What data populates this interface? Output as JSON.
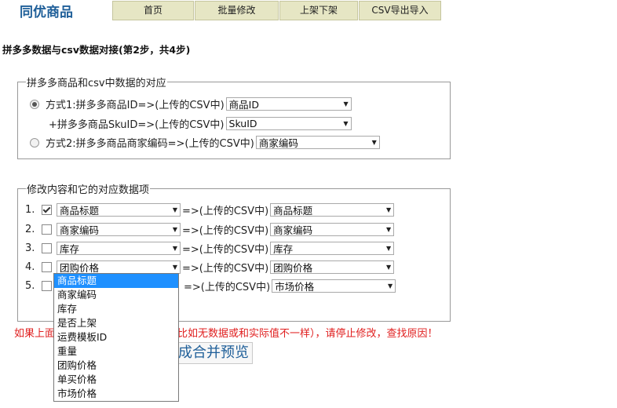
{
  "logo": "同优商品",
  "nav": [
    "首页",
    "批量修改",
    "上架下架",
    "CSV导出导入"
  ],
  "step_title": "拼多多数据与csv数据对接(第2步，共4步)",
  "match_box": {
    "legend": "拼多多商品和csv中数据的对应",
    "mode1_label": "方式1:拼多多商品ID=>(上传的CSV中)",
    "mode1_select": "商品ID",
    "mode1_sku_label": "+拼多多商品SkuID=>(上传的CSV中)",
    "mode1_sku_select": "SkuID",
    "mode2_label": "方式2:拼多多商品商家编码=>(上传的CSV中)",
    "mode2_select": "商家编码"
  },
  "modify_box": {
    "legend": "修改内容和它的对应数据项",
    "arrow_text": "=>(上传的CSV中)",
    "rows": [
      {
        "num": "1.",
        "field": "商品标题",
        "csv": "商品标题"
      },
      {
        "num": "2.",
        "field": "商家编码",
        "csv": "商家编码"
      },
      {
        "num": "3.",
        "field": "库存",
        "csv": "库存"
      },
      {
        "num": "4.",
        "field": "团购价格",
        "csv": "团购价格"
      },
      {
        "num": "5.",
        "field": "",
        "csv": "市场价格"
      }
    ]
  },
  "row_checked": [
    true,
    false,
    false,
    false,
    false
  ],
  "warning_left": "如果上面",
  "warning_right": "比如无数据或和实际值不一样），请停止修改，查找原因！",
  "preview_button": "成合并预览",
  "dropdown_options": [
    "商品标题",
    "商家编码",
    "库存",
    "是否上架",
    "运费模板ID",
    "重量",
    "团购价格",
    "单买价格",
    "市场价格"
  ],
  "dropdown_highlighted": "商品标题"
}
